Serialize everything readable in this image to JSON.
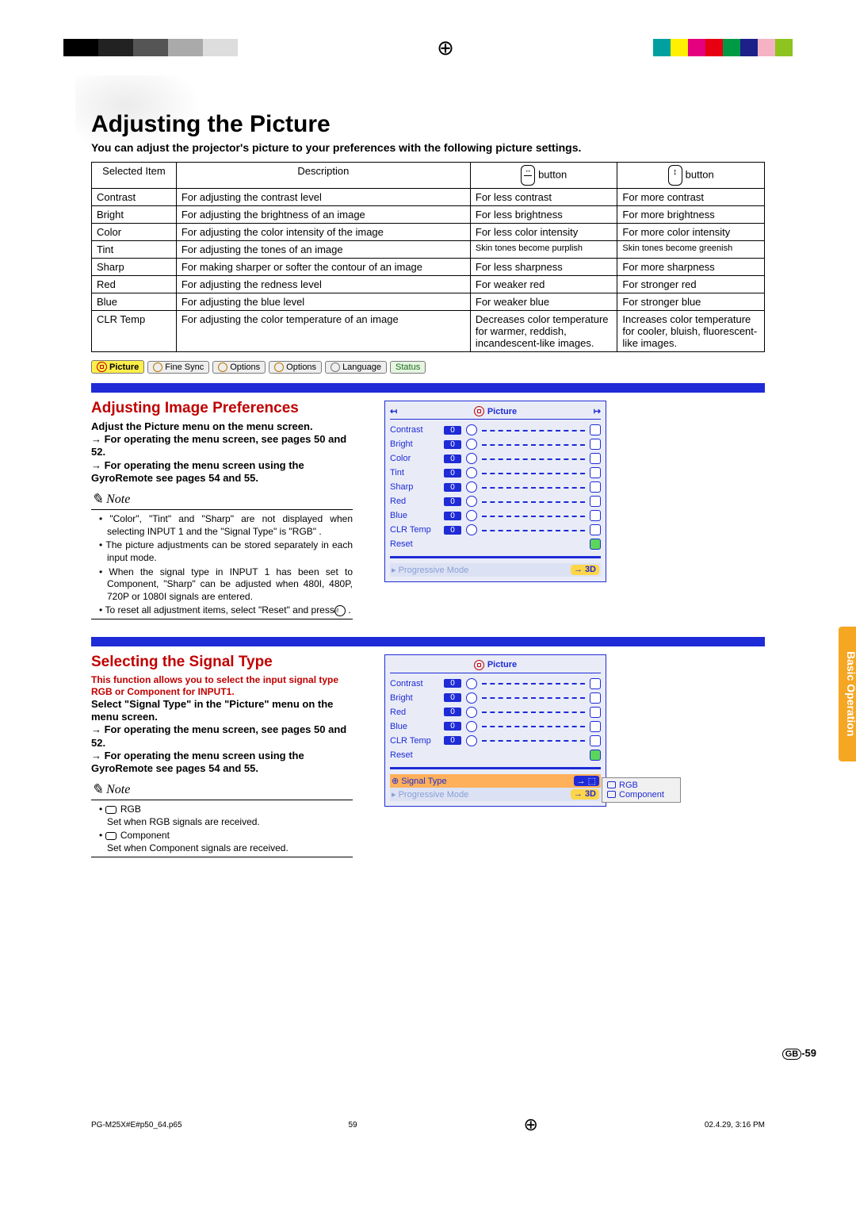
{
  "header": {
    "title": "Adjusting the Picture",
    "subtitle": "You can adjust the projector's picture to your preferences with the following picture settings."
  },
  "table": {
    "headers": [
      "Selected Item",
      "Description",
      "button",
      "button"
    ],
    "rows": [
      [
        "Contrast",
        "For adjusting the contrast level",
        "For less contrast",
        "For more contrast"
      ],
      [
        "Bright",
        "For adjusting the brightness of an image",
        "For less brightness",
        "For more brightness"
      ],
      [
        "Color",
        "For adjusting the color intensity of the image",
        "For less color intensity",
        "For more color intensity"
      ],
      [
        "Tint",
        "For adjusting the tones of an image",
        "Skin tones become purplish",
        "Skin tones become greenish"
      ],
      [
        "Sharp",
        "For making sharper or softer the contour of an image",
        "For less sharpness",
        "For more sharpness"
      ],
      [
        "Red",
        "For adjusting the redness level",
        "For weaker red",
        "For stronger red"
      ],
      [
        "Blue",
        "For adjusting the blue level",
        "For weaker blue",
        "For stronger blue"
      ],
      [
        "CLR Temp",
        "For adjusting the color temperature of an image",
        "Decreases color temperature for warmer, reddish, incandescent-like images.",
        "Increases color temperature for cooler, bluish, fluorescent-like images."
      ]
    ]
  },
  "menubar": [
    "Picture",
    "Fine Sync",
    "Options",
    "Options",
    "Language",
    "Status"
  ],
  "section1": {
    "heading": "Adjusting Image Preferences",
    "lead": "Adjust the Picture menu on the menu screen.",
    "ref1": "→ For operating the menu screen, see pages 50 and 52.",
    "ref2": "→ For operating the menu screen using the GyroRemote see pages 54 and 55.",
    "note_label": "Note",
    "notes": [
      "\"Color\", \"Tint\" and \"Sharp\" are not displayed when selecting INPUT 1 and the \"Signal Type\" is \"RGB\" .",
      "The picture adjustments can be stored separately in each input mode.",
      "When the signal type in INPUT 1 has been set to Component, \"Sharp\" can be adjusted when 480I, 480P, 720P or 1080I signals are entered.",
      "To reset all adjustment items, select \"Reset\" and press        ."
    ]
  },
  "osd1": {
    "title": "Picture",
    "items": [
      "Contrast",
      "Bright",
      "Color",
      "Tint",
      "Sharp",
      "Red",
      "Blue",
      "CLR Temp",
      "Reset"
    ],
    "value": "0",
    "footer": "Progressive Mode",
    "footer_val": "3D"
  },
  "section2": {
    "heading": "Selecting the Signal Type",
    "intro": "This function allows you to select the input signal type RGB or Component for INPUT1.",
    "lead": "Select \"Signal Type\" in the \"Picture\" menu on the menu screen.",
    "ref1": "→ For operating the menu screen, see pages 50 and 52.",
    "ref2": "→ For operating the menu screen using the GyroRemote see pages 54 and 55.",
    "note_label": "Note",
    "notes_rgb": "RGB",
    "notes_rgb_desc": "Set when RGB signals are received.",
    "notes_comp": "Component",
    "notes_comp_desc": "Set when Component signals are received."
  },
  "osd2": {
    "title": "Picture",
    "items": [
      "Contrast",
      "Bright",
      "Red",
      "Blue",
      "CLR Temp",
      "Reset"
    ],
    "value": "0",
    "signal_label": "Signal Type",
    "signal_arrow": "→",
    "footer": "Progressive Mode",
    "footer_val": "3D",
    "popout": [
      "RGB",
      "Component"
    ]
  },
  "sidetab": "Basic Operation",
  "page_number_label": "-59",
  "page_number_prefix": "GB",
  "footer": {
    "file": "PG-M25X#E#p50_64.p65",
    "page": "59",
    "timestamp": "02.4.29, 3:16 PM"
  }
}
